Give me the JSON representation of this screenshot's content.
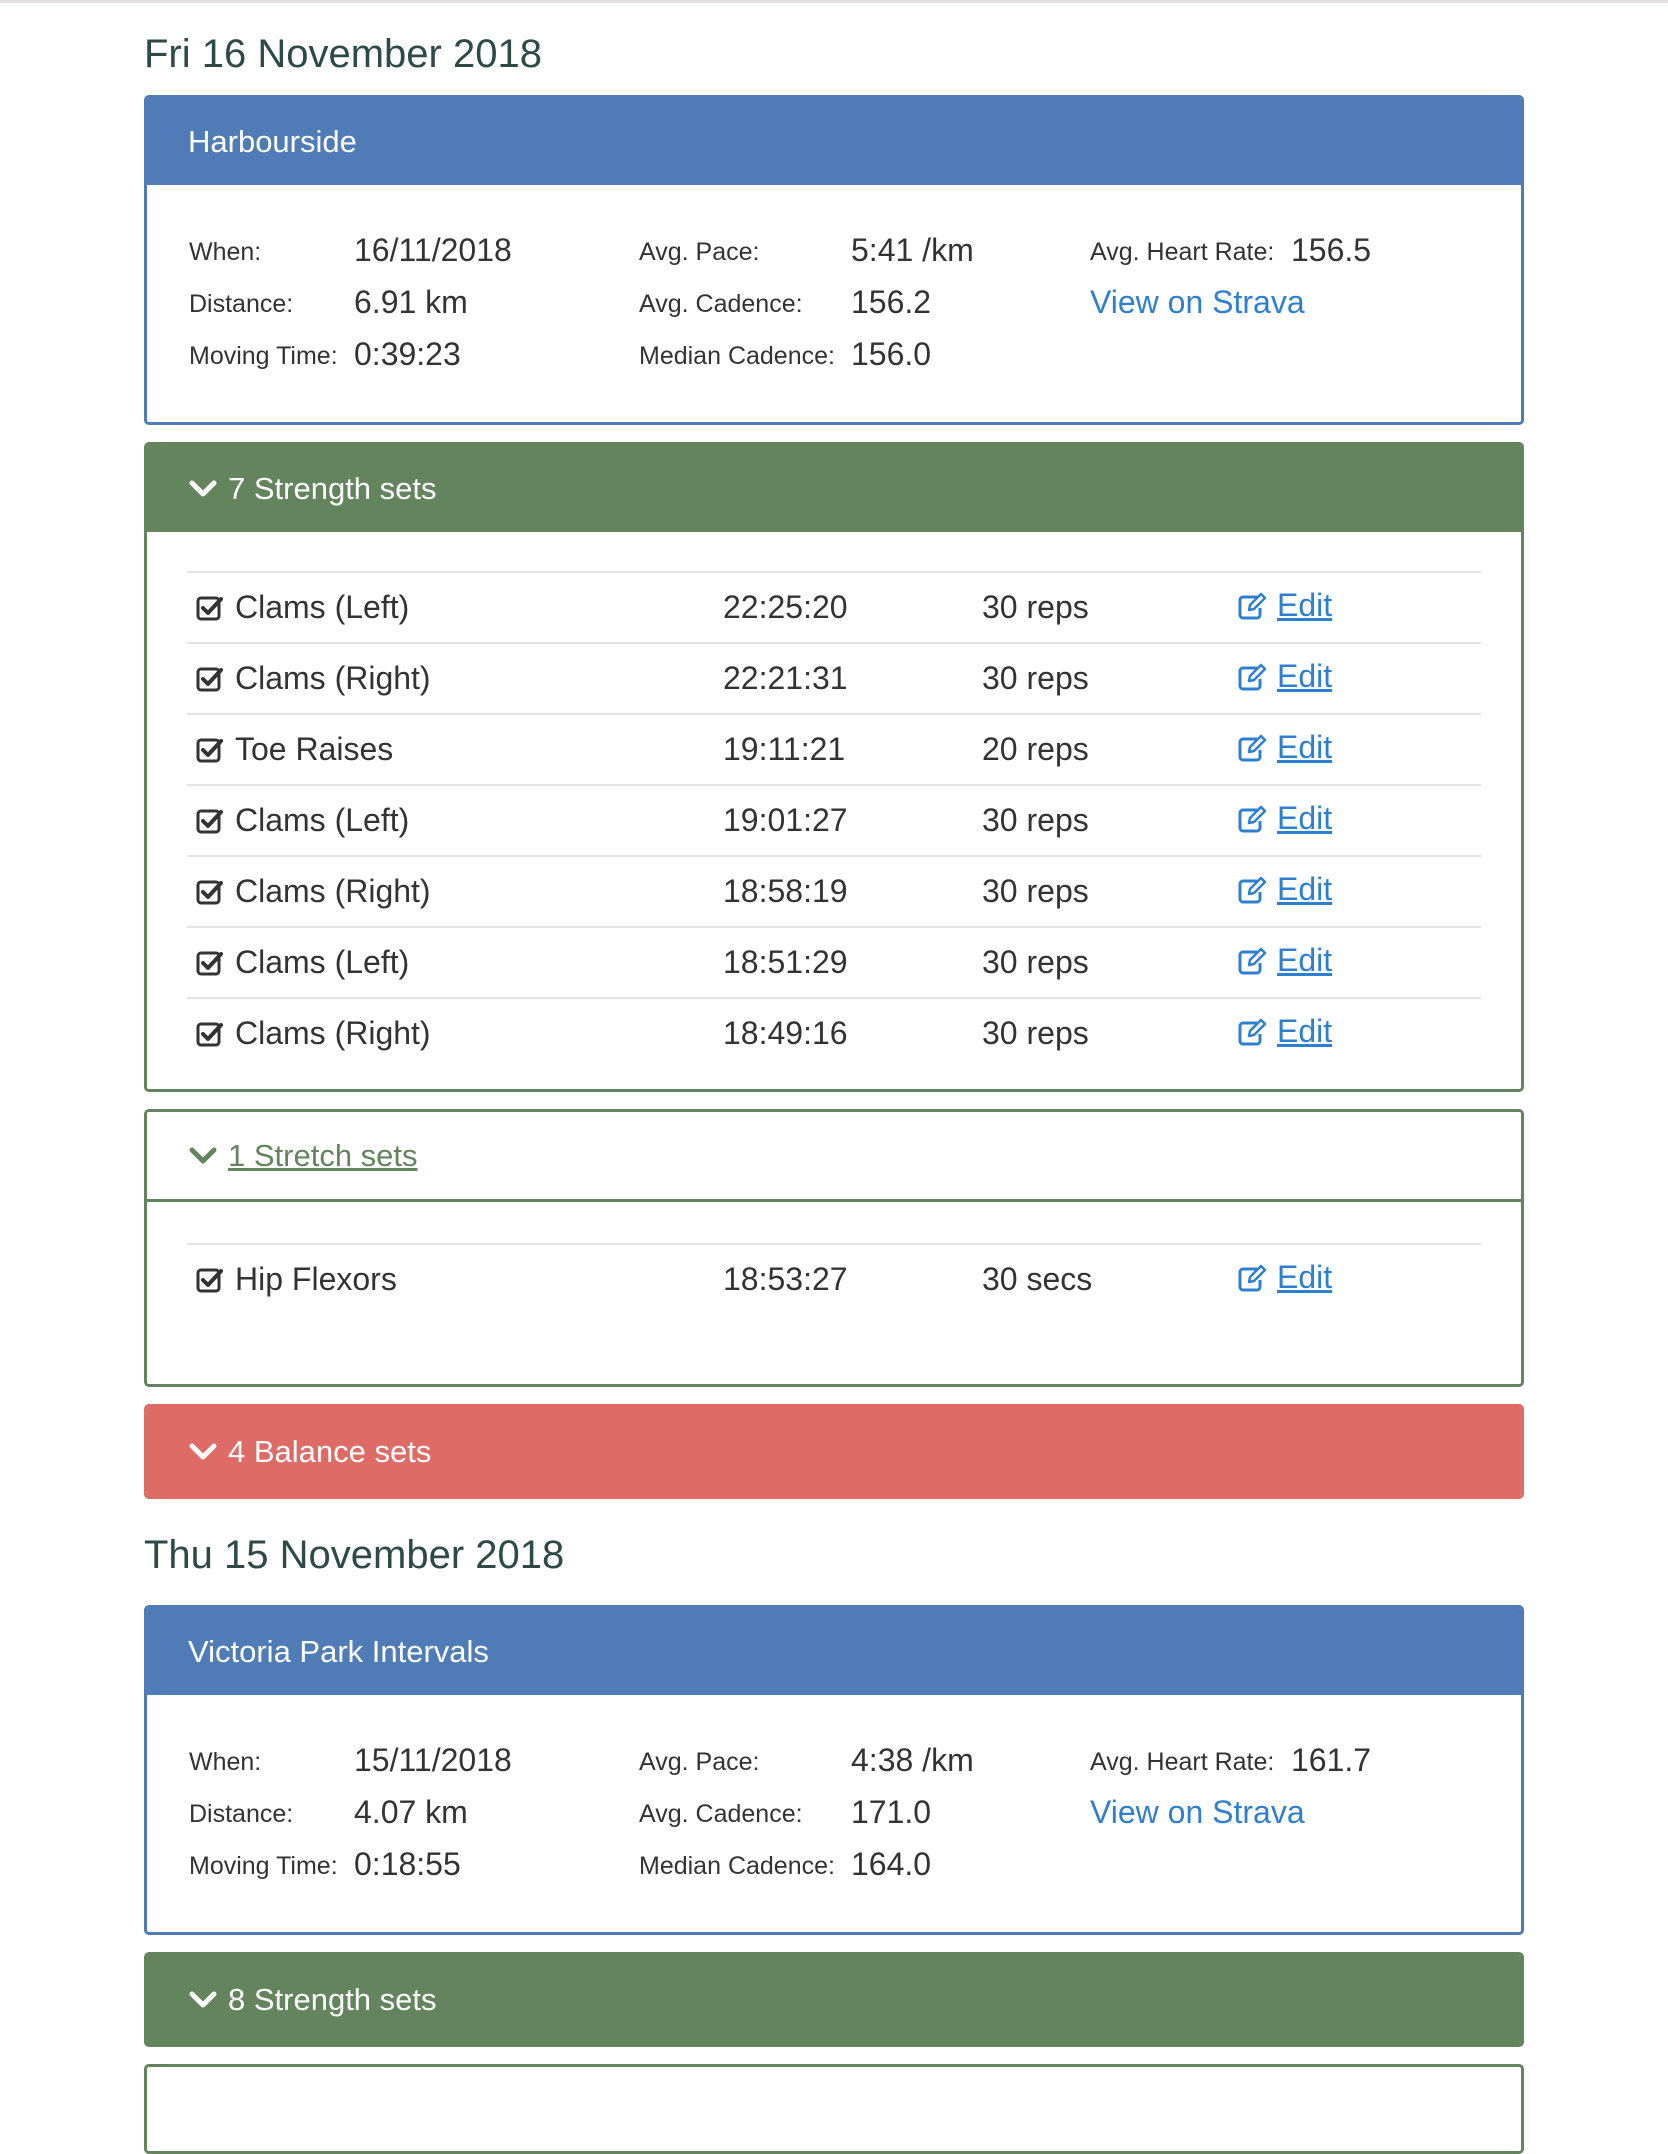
{
  "days": [
    {
      "heading": "Fri 16 November 2018",
      "activity": {
        "title": "Harbourside",
        "when_label": "When:",
        "when": "16/11/2018",
        "distance_label": "Distance:",
        "distance": "6.91 km",
        "moving_time_label": "Moving Time:",
        "moving_time": "0:39:23",
        "avg_pace_label": "Avg. Pace:",
        "avg_pace": "5:41 /km",
        "avg_cadence_label": "Avg. Cadence:",
        "avg_cadence": "156.2",
        "median_cadence_label": "Median Cadence:",
        "median_cadence": "156.0",
        "avg_hr_label": "Avg. Heart Rate:",
        "avg_hr": "156.5",
        "strava_link": "View on Strava"
      },
      "strength": {
        "title": "7 Strength sets",
        "sets": [
          {
            "name": "Clams (Left)",
            "time": "22:25:20",
            "amount": "30 reps",
            "edit": "Edit"
          },
          {
            "name": "Clams (Right)",
            "time": "22:21:31",
            "amount": "30 reps",
            "edit": "Edit"
          },
          {
            "name": "Toe Raises",
            "time": "19:11:21",
            "amount": "20 reps",
            "edit": "Edit"
          },
          {
            "name": "Clams (Left)",
            "time": "19:01:27",
            "amount": "30 reps",
            "edit": "Edit"
          },
          {
            "name": "Clams (Right)",
            "time": "18:58:19",
            "amount": "30 reps",
            "edit": "Edit"
          },
          {
            "name": "Clams (Left)",
            "time": "18:51:29",
            "amount": "30 reps",
            "edit": "Edit"
          },
          {
            "name": "Clams (Right)",
            "time": "18:49:16",
            "amount": "30 reps",
            "edit": "Edit"
          }
        ]
      },
      "stretch": {
        "title": "1 Stretch sets",
        "sets": [
          {
            "name": "Hip Flexors",
            "time": "18:53:27",
            "amount": "30 secs",
            "edit": "Edit"
          }
        ]
      },
      "balance": {
        "title": "4 Balance sets"
      }
    },
    {
      "heading": "Thu 15 November 2018",
      "activity": {
        "title": "Victoria Park Intervals",
        "when_label": "When:",
        "when": "15/11/2018",
        "distance_label": "Distance:",
        "distance": "4.07 km",
        "moving_time_label": "Moving Time:",
        "moving_time": "0:18:55",
        "avg_pace_label": "Avg. Pace:",
        "avg_pace": "4:38 /km",
        "avg_cadence_label": "Avg. Cadence:",
        "avg_cadence": "171.0",
        "median_cadence_label": "Median Cadence:",
        "median_cadence": "164.0",
        "avg_hr_label": "Avg. Heart Rate:",
        "avg_hr": "161.7",
        "strava_link": "View on Strava"
      },
      "strength": {
        "title": "8 Strength sets"
      }
    }
  ],
  "colors": {
    "activity_blue": "#4f7cb6",
    "strength_green": "#63845d",
    "balance_red": "#df6b67",
    "link_blue": "#2f7fd0",
    "heading_teal": "#2d4a48"
  },
  "icons": {
    "panel_toggle": "chevron-down-icon",
    "set_done": "checkbox-checked-icon",
    "edit": "edit-icon"
  }
}
